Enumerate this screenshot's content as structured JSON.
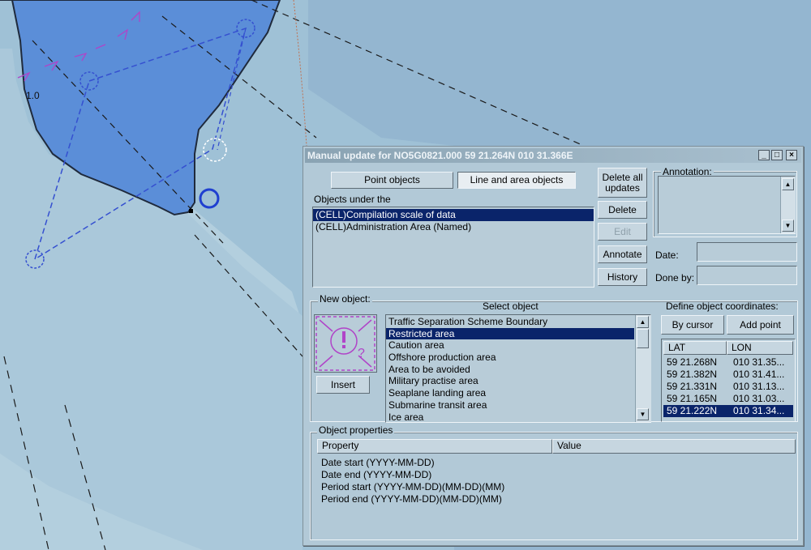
{
  "map": {
    "depth_label": "1.0"
  },
  "dialog": {
    "title": "Manual update for NO5G0821.000  59 21.264N  010 31.366E",
    "window_buttons": {
      "minimize": "_",
      "maximize": "□",
      "close": "×"
    },
    "point_objects_label": "Point objects",
    "line_area_objects_label": "Line and area objects",
    "objects_under_label": "Objects under the",
    "objects_under": [
      {
        "label": "(CELL)Compilation scale of data",
        "selected": true
      },
      {
        "label": "(CELL)Administration Area (Named)",
        "selected": false
      }
    ],
    "delete_all_label_1": "Delete all",
    "delete_all_label_2": "updates",
    "delete_label": "Delete",
    "edit_label": "Edit",
    "annotate_label": "Annotate",
    "history_label": "History",
    "annotation_label": "Annotation:",
    "date_label": "Date:",
    "done_by_label": "Done by:",
    "date_value": "",
    "done_by_value": "",
    "new_object_label": "New object:",
    "select_object_label": "Select object",
    "insert_label": "Insert",
    "object_types": [
      {
        "label": "Traffic Separation Scheme  Boundary",
        "selected": false
      },
      {
        "label": "Restricted area",
        "selected": true
      },
      {
        "label": "Caution area",
        "selected": false
      },
      {
        "label": "Offshore production area",
        "selected": false
      },
      {
        "label": "Area to be avoided",
        "selected": false
      },
      {
        "label": "Military practise area",
        "selected": false
      },
      {
        "label": "Seaplane landing area",
        "selected": false
      },
      {
        "label": "Submarine transit area",
        "selected": false
      },
      {
        "label": "Ice area",
        "selected": false
      }
    ],
    "define_coords_label": "Define object coordinates:",
    "by_cursor_label": "By cursor",
    "add_point_label": "Add point",
    "lat_header": "LAT",
    "lon_header": "LON",
    "coordinates": [
      {
        "lat": "59 21.268N",
        "lon": "010 31.35...",
        "selected": false
      },
      {
        "lat": "59 21.382N",
        "lon": "010 31.41...",
        "selected": false
      },
      {
        "lat": "59 21.331N",
        "lon": "010 31.13...",
        "selected": false
      },
      {
        "lat": "59 21.165N",
        "lon": "010 31.03...",
        "selected": false
      },
      {
        "lat": "59 21.222N",
        "lon": "010 31.34...",
        "selected": true
      }
    ],
    "object_properties_label": "Object properties",
    "property_header": "Property",
    "value_header": "Value",
    "properties": [
      "Date start (YYYY-MM-DD)",
      "Date end (YYYY-MM-DD)",
      "Period start (YYYY-MM-DD)(MM-DD)(MM)",
      "Period end (YYYY-MM-DD)(MM-DD)(MM)"
    ]
  },
  "colors": {
    "sea_deep": "#94b6d0",
    "sea_mid": "#9fc1d6",
    "sea_shallow": "#b3cfde",
    "land": "#5b8ed8",
    "dialog_bg": "#b2c9d7",
    "selection": "#0a246a",
    "route": "#3550d0",
    "symbol": "#b044c8"
  }
}
